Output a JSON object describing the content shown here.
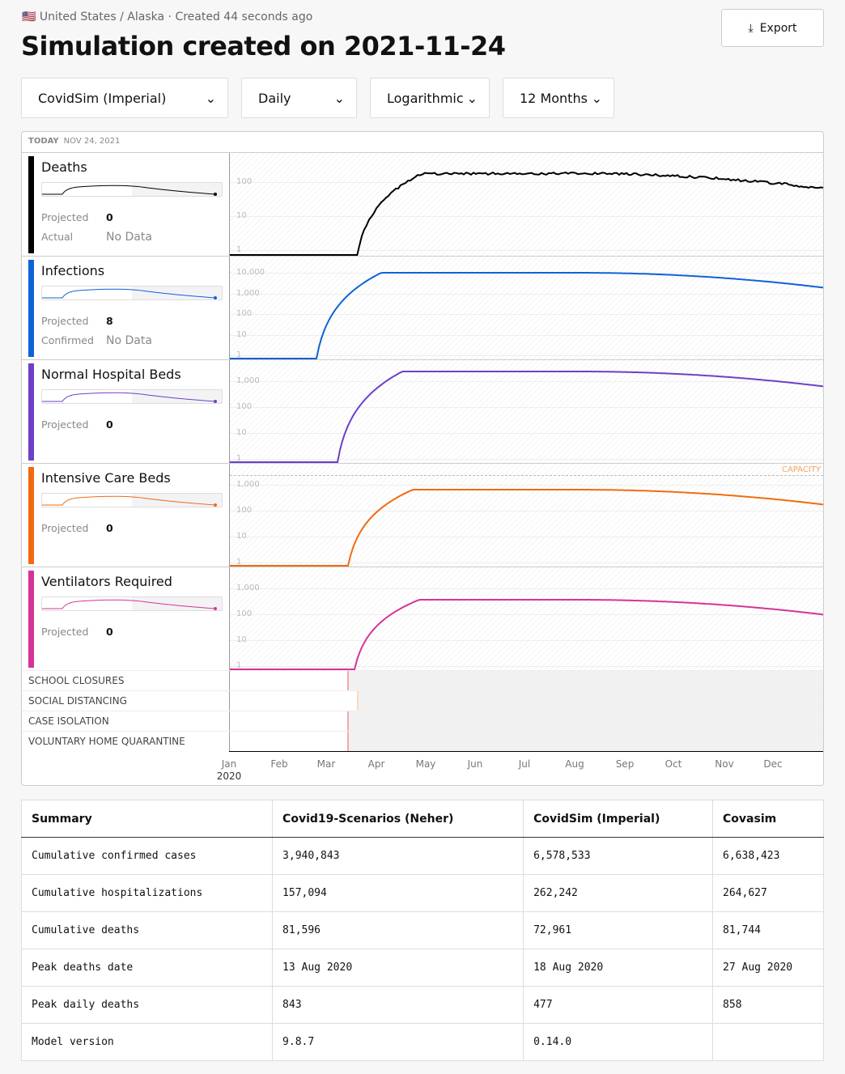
{
  "header": {
    "flag": "🇺🇸",
    "breadcrumb": "United States / Alaska · Created 44 seconds ago",
    "title": "Simulation created on 2021-11-24",
    "export_label": "Export"
  },
  "controls": [
    {
      "value": "CovidSim (Imperial)"
    },
    {
      "value": "Daily"
    },
    {
      "value": "Logarithmic"
    },
    {
      "value": "12 Months"
    }
  ],
  "today": {
    "label": "TODAY",
    "date": "NOV 24, 2021"
  },
  "metrics": [
    {
      "name": "Deaths",
      "color": "#000000",
      "projected_label": "Projected",
      "projected": "0",
      "actual_label": "Actual",
      "actual": "No Data",
      "ticks": [
        "100",
        "10",
        "1"
      ]
    },
    {
      "name": "Infections",
      "color": "#0f62d8",
      "projected_label": "Projected",
      "projected": "8",
      "actual_label": "Confirmed",
      "actual": "No Data",
      "ticks": [
        "10,000",
        "1,000",
        "100",
        "10",
        "1"
      ]
    },
    {
      "name": "Normal Hospital Beds",
      "color": "#6e3fc7",
      "projected_label": "Projected",
      "projected": "0",
      "ticks": [
        "1,000",
        "100",
        "10",
        "1"
      ]
    },
    {
      "name": "Intensive Care Beds",
      "color": "#f26a0f",
      "projected_label": "Projected",
      "projected": "0",
      "ticks": [
        "1,000",
        "100",
        "10",
        "1"
      ],
      "capacity_label": "CAPACITY"
    },
    {
      "name": "Ventilators Required",
      "color": "#d63496",
      "projected_label": "Projected",
      "projected": "0",
      "ticks": [
        "1,000",
        "100",
        "10",
        "1"
      ]
    }
  ],
  "interventions": [
    "SCHOOL CLOSURES",
    "SOCIAL DISTANCING",
    "CASE ISOLATION",
    "VOLUNTARY HOME QUARANTINE"
  ],
  "axis": {
    "months": [
      "Jan",
      "Feb",
      "Mar",
      "Apr",
      "May",
      "Jun",
      "Jul",
      "Aug",
      "Sep",
      "Oct",
      "Nov",
      "Dec"
    ],
    "year": "2020"
  },
  "table": {
    "headers": [
      "Summary",
      "Covid19-Scenarios (Neher)",
      "CovidSim (Imperial)",
      "Covasim"
    ],
    "rows": [
      [
        "Cumulative confirmed cases",
        "3,940,843",
        "6,578,533",
        "6,638,423"
      ],
      [
        "Cumulative hospitalizations",
        "157,094",
        "262,242",
        "264,627"
      ],
      [
        "Cumulative deaths",
        "81,596",
        "72,961",
        "81,744"
      ],
      [
        "Peak deaths date",
        "13 Aug 2020",
        "18 Aug 2020",
        "27 Aug 2020"
      ],
      [
        "Peak daily deaths",
        "843",
        "477",
        "858"
      ],
      [
        "Model version",
        "9.8.7",
        "0.14.0",
        ""
      ]
    ]
  }
}
